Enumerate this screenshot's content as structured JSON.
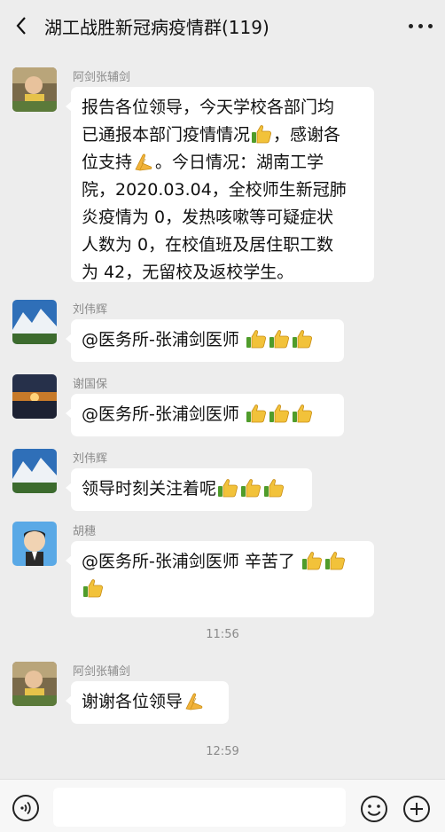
{
  "header": {
    "title": "湖工战胜新冠病疫情群(119)"
  },
  "messages": [
    {
      "sender": "阿剑张辅剑",
      "lines": [
        "报告各位领导，今天学校各部门均",
        "已通报本部门疫情情况",
        "，感谢各",
        "位支持",
        "。今日情况：湖南工学",
        "院，2020.03.04，全校师生新冠肺",
        "炎疫情为 0，发热咳嗽等可疑症状",
        "人数为 0，在校值班及居住职工数",
        "为 42，无留校及返校学生。"
      ]
    },
    {
      "sender": "刘伟辉",
      "text": "@医务所-张浦剑医师 "
    },
    {
      "sender": "谢国保",
      "text": "@医务所-张浦剑医师 "
    },
    {
      "sender": "刘伟辉",
      "text": "领导时刻关注着呢"
    },
    {
      "sender": "胡穗",
      "text": "@医务所-张浦剑医师 辛苦了 "
    },
    {
      "sender": "阿剑张辅剑",
      "text": "谢谢各位领导"
    }
  ],
  "times": [
    "11:56",
    "12:59"
  ],
  "icons": {
    "back": "chevron-left-icon",
    "more": "more-icon",
    "thumbs": "thumbs-up-emoji",
    "thanks": "pray-emoji",
    "voice": "voice-icon",
    "emoji": "emoji-icon",
    "plus": "plus-icon"
  },
  "colors": {
    "background": "#ededed",
    "bubble": "#ffffff",
    "secondary_text": "#8a8a8a"
  }
}
